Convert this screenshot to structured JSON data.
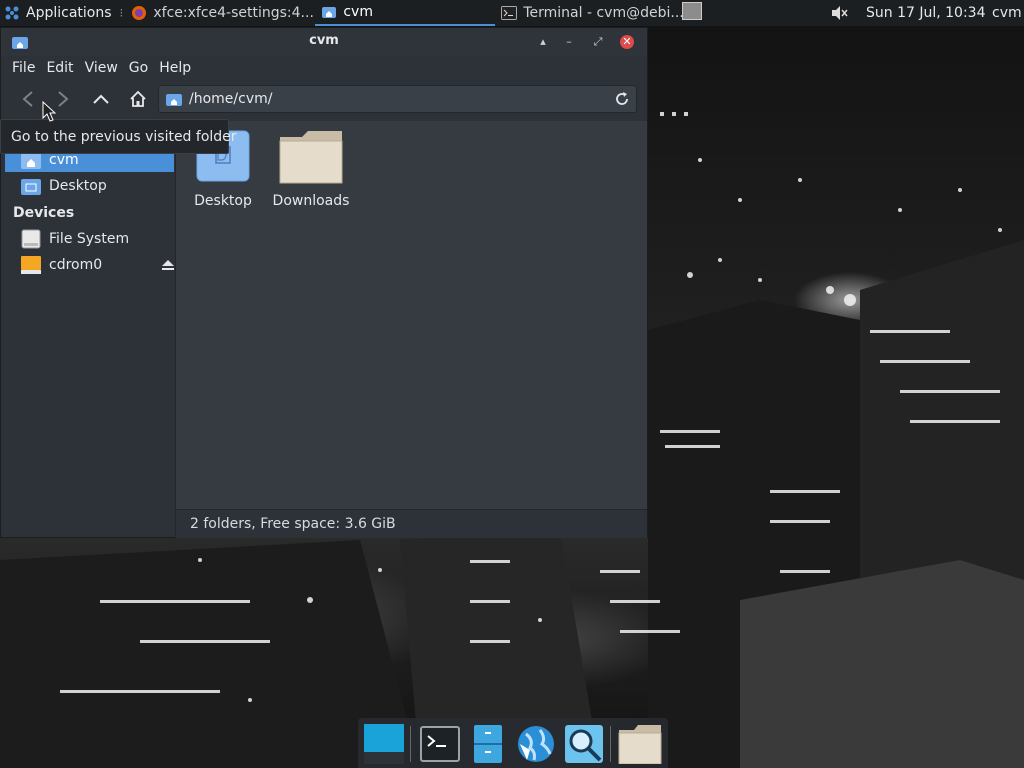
{
  "top_panel": {
    "applications_label": "Applications",
    "tasks": [
      {
        "label": "xfce:xfce4-settings:4...",
        "icon": "firefox-icon",
        "active": false
      },
      {
        "label": "cvm",
        "icon": "folder-home-icon",
        "active": true
      },
      {
        "label": "Terminal - cvm@debi...",
        "icon": "terminal-icon",
        "active": false
      }
    ],
    "clock": "Sun 17 Jul, 10:34",
    "user": "cvm"
  },
  "window": {
    "title": "cvm",
    "menu": [
      "File",
      "Edit",
      "View",
      "Go",
      "Help"
    ],
    "location": "/home/cvm/",
    "sidebar": {
      "places": [
        "cvm",
        "Desktop"
      ],
      "devices_header": "Devices",
      "devices": [
        "File System",
        "cdrom0"
      ]
    },
    "files": [
      {
        "name": "Desktop",
        "icon": "desktop-folder-icon"
      },
      {
        "name": "Downloads",
        "icon": "folder-icon"
      }
    ],
    "status": "2 folders, Free space: 3.6 GiB",
    "tooltip": "Go to the previous visited folder"
  },
  "colors": {
    "accent": "#4a90d9",
    "window_bg": "#2d3238",
    "close_button": "#dd4b4b"
  },
  "dock": [
    "show-desktop-icon",
    "terminal-icon",
    "file-manager-icon",
    "web-browser-icon",
    "app-finder-icon",
    "home-folder-icon"
  ]
}
